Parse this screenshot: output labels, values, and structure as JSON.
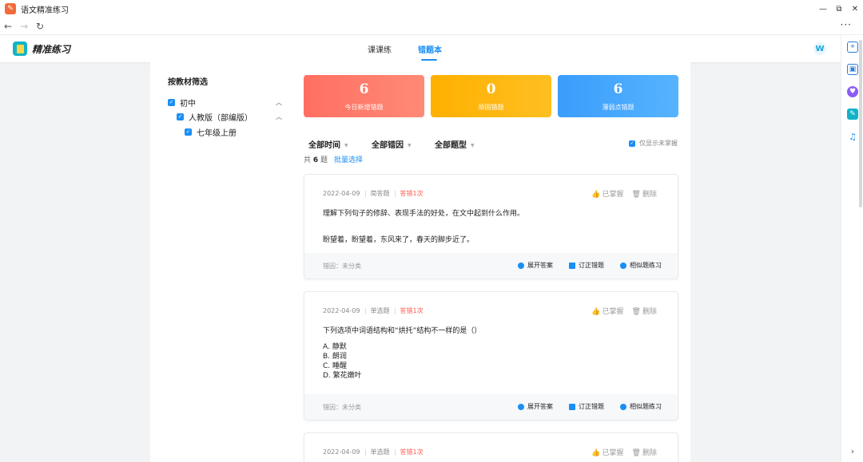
{
  "window": {
    "title": "语文精准练习",
    "controls": [
      "—",
      "⧉",
      "✕"
    ]
  },
  "navbar": {
    "back": "←",
    "forward": "→",
    "reload": "↻",
    "more": "···"
  },
  "header": {
    "brand": "精准练习",
    "tabs": [
      {
        "label": "课课练",
        "active": false
      },
      {
        "label": "错题本",
        "active": true
      }
    ],
    "avatar": "W"
  },
  "filter": {
    "title": "按教材筛选",
    "items": [
      {
        "label": "初中",
        "checked": true,
        "level": 0,
        "expanded": true
      },
      {
        "label": "人教版（部编版）",
        "checked": true,
        "level": 1,
        "expanded": true
      },
      {
        "label": "七年级上册",
        "checked": true,
        "level": 2
      }
    ]
  },
  "stats": [
    {
      "value": "6",
      "label": "今日新增错题",
      "color": "#ff6f62"
    },
    {
      "value": "0",
      "label": "顽固错题",
      "color": "#ffb000"
    },
    {
      "value": "6",
      "label": "薄弱点错题",
      "color": "#3a9dfb"
    }
  ],
  "filters_bar": {
    "time": "全部时间",
    "reason": "全部错因",
    "type": "全部题型",
    "only_unmastered": "仅显示未掌握"
  },
  "summary": {
    "prefix": "共",
    "count": "6",
    "suffix": "题",
    "batch": "批量选择"
  },
  "card_labels": {
    "mastered": "已掌握",
    "delete": "删除",
    "expand": "展开答案",
    "correct": "订正错题",
    "similar": "相似题练习"
  },
  "cards": [
    {
      "date": "2022-04-09",
      "type": "简答题",
      "wrong": "答错1次",
      "question": "理解下列句子的修辞、表现手法的好处，在文中起到什么作用。",
      "quote": "盼望着，盼望着，东风来了，春天的脚步近了。",
      "reason": "错因：未分类"
    },
    {
      "date": "2022-04-09",
      "type": "单选题",
      "wrong": "答错1次",
      "question": "下列选项中词语结构和“烘托”结构不一样的是（）",
      "options": [
        "A. 静默",
        "B. 朗润",
        "C. 睡醒",
        "D. 繁花嫩叶"
      ],
      "reason": "错因：未分类"
    },
    {
      "date": "2022-04-09",
      "type": "单选题",
      "wrong": "答错1次"
    }
  ],
  "colors": {
    "accent": "#1a8ef5",
    "error": "#ff5a4b"
  }
}
